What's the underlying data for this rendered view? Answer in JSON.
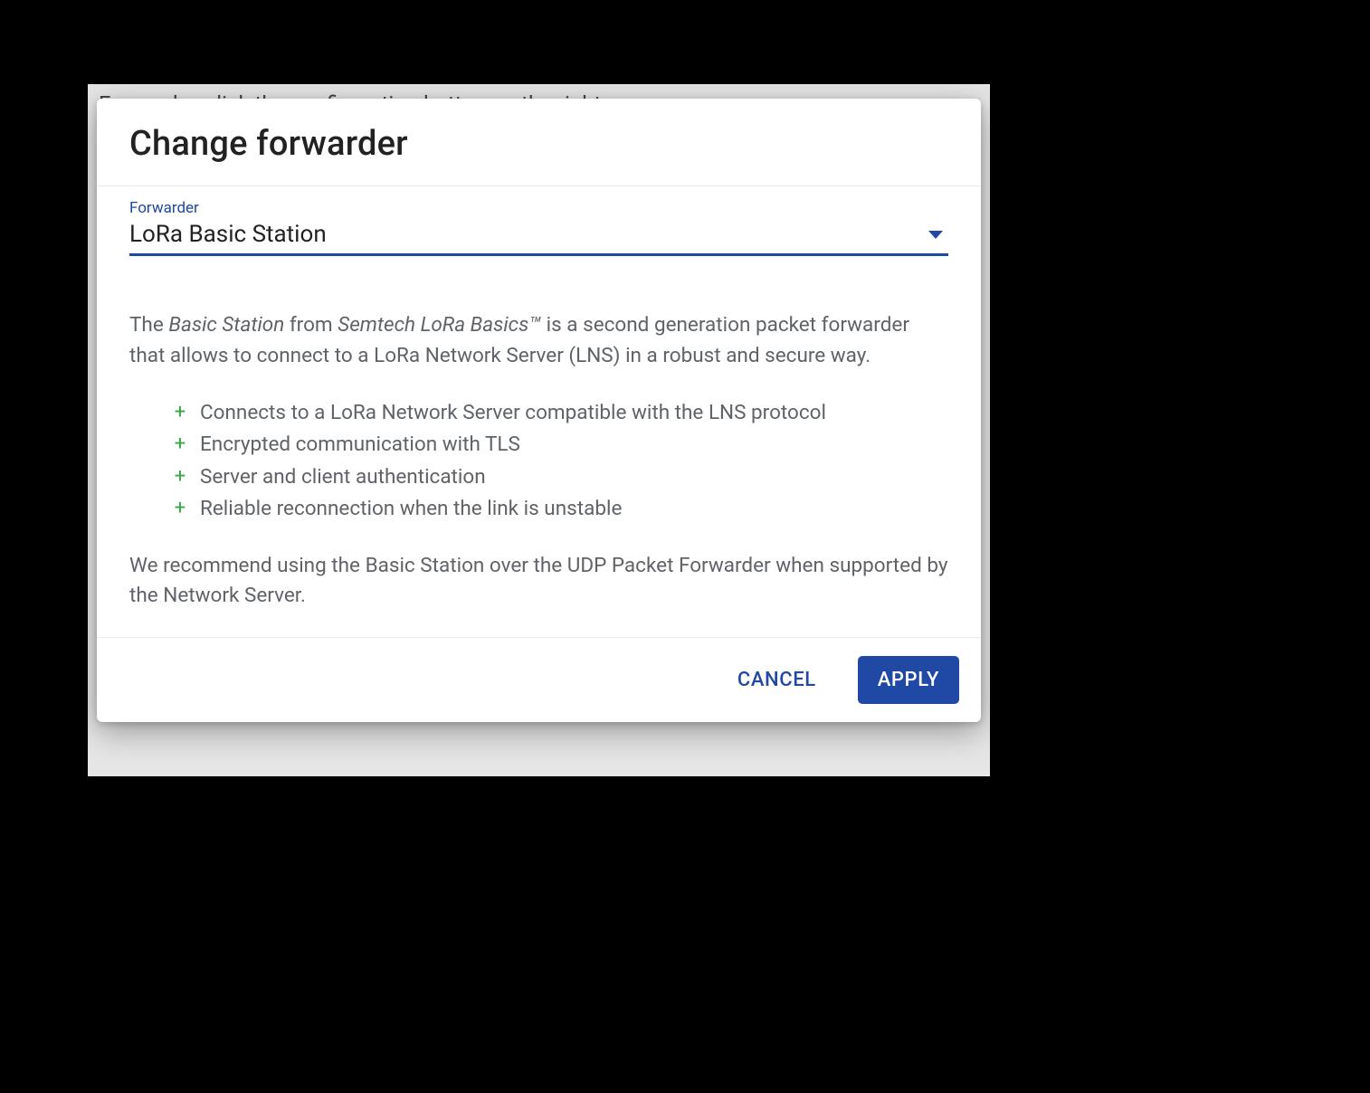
{
  "background": {
    "truncated_line": "Forwarder, click the configuration button on the right."
  },
  "dialog": {
    "title": "Change forwarder",
    "field": {
      "label": "Forwarder",
      "value": "LoRa Basic Station"
    },
    "description": {
      "pre": "The ",
      "em1": "Basic Station",
      "mid": " from ",
      "em2": "Semtech LoRa Basics™",
      "post": " is a second generation packet forwarder that allows to connect to a LoRa Network Server (LNS) in a robust and secure way."
    },
    "features": [
      "Connects to a LoRa Network Server compatible with the LNS protocol",
      "Encrypted communication with TLS",
      "Server and client authentication",
      "Reliable reconnection when the link is unstable"
    ],
    "recommendation": "We recommend using the Basic Station over the UDP Packet Forwarder when supported by the Network Server.",
    "actions": {
      "cancel": "CANCEL",
      "apply": "APPLY"
    }
  },
  "colors": {
    "primary": "#1f49a4",
    "plus": "#3aa84a",
    "body_text": "#5f6368"
  }
}
